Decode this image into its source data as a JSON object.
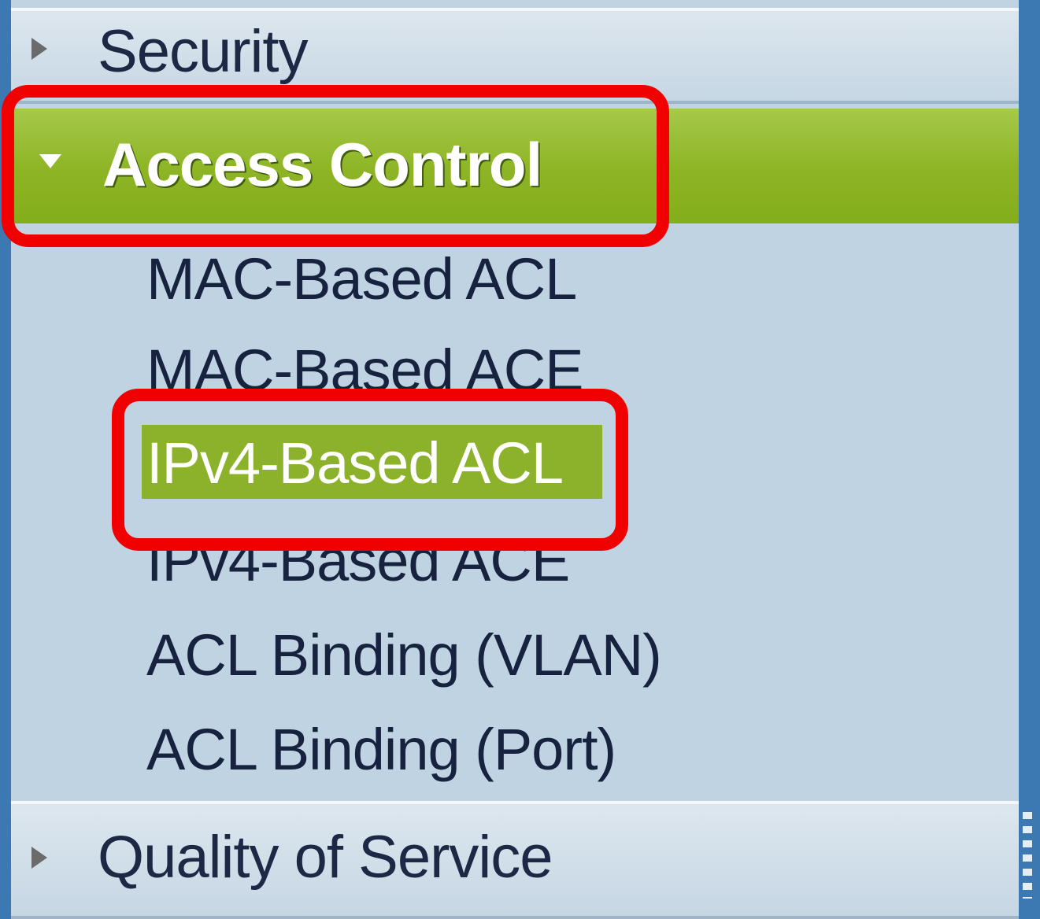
{
  "nav": {
    "sections": {
      "security": {
        "label": "Security"
      },
      "access_control": {
        "label": "Access Control",
        "items": [
          "MAC-Based ACL",
          "MAC-Based ACE",
          "IPv4-Based ACL",
          "IPv4-Based ACE",
          "ACL Binding (VLAN)",
          "ACL Binding (Port)"
        ],
        "selected_item": "IPv4-Based ACL"
      },
      "qos": {
        "label": "Quality of Service"
      }
    },
    "colors": {
      "active_green": "#8db424",
      "highlight_red": "#f00000",
      "panel_bg": "#c0d3e2",
      "border_blue": "#3c79b3"
    }
  }
}
